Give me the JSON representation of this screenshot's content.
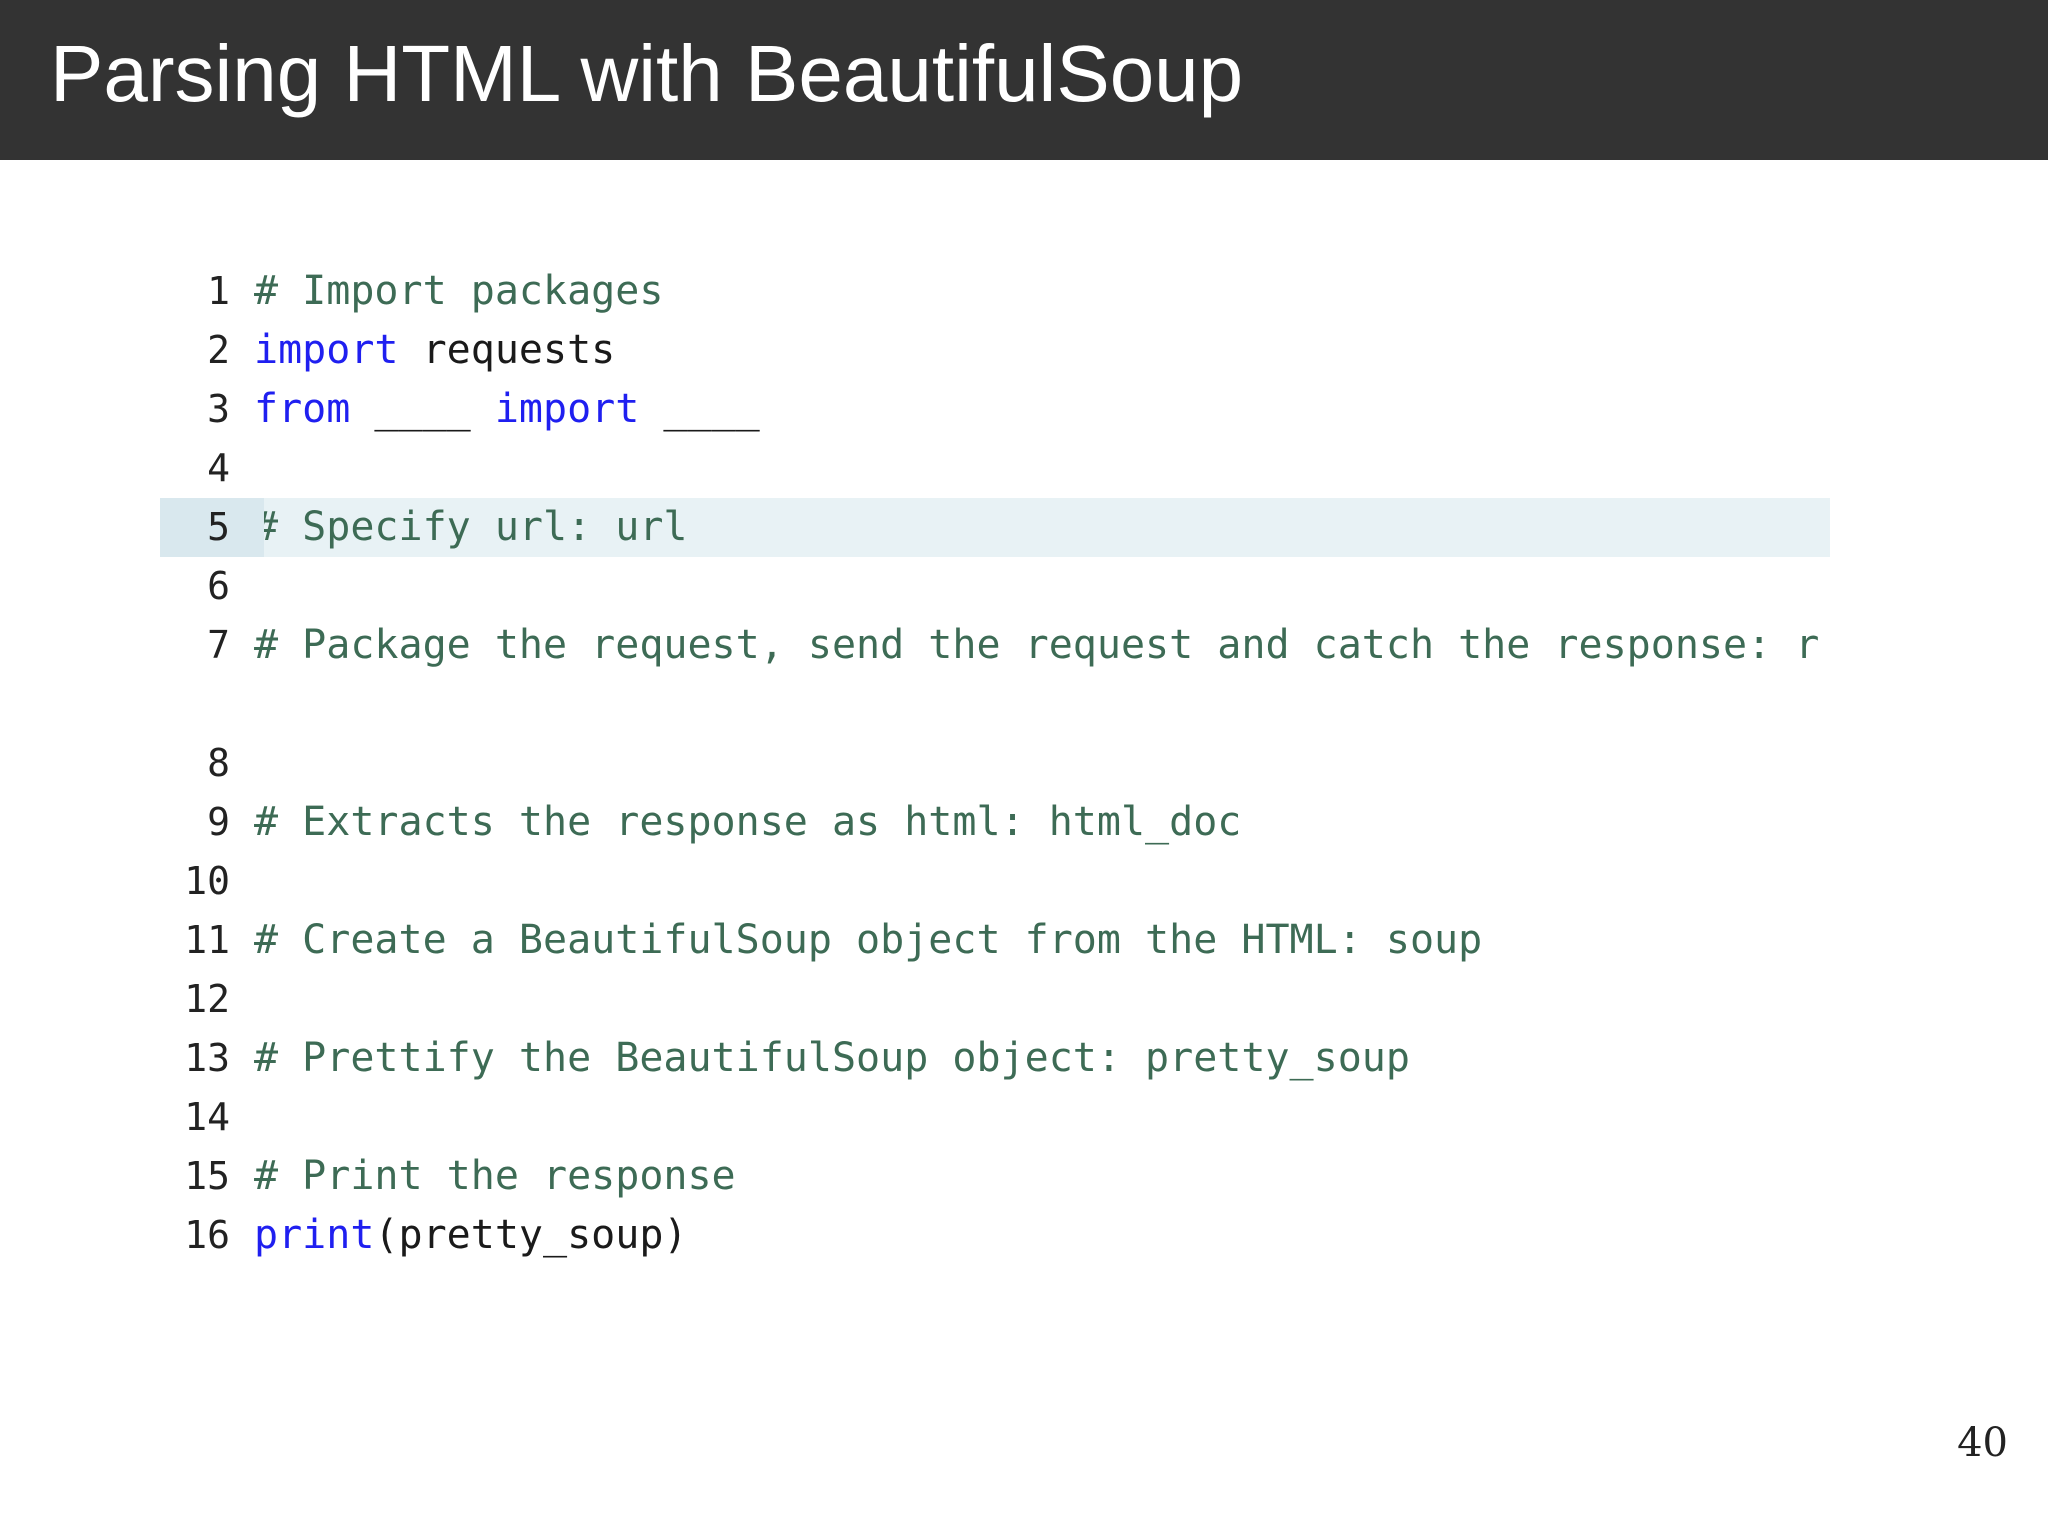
{
  "slide": {
    "title": "Parsing HTML with BeautifulSoup",
    "page_number": "40"
  },
  "editor": {
    "active_line": "5",
    "lines": [
      {
        "number": "1",
        "tokens": [
          {
            "type": "comment",
            "text": "# Import packages"
          }
        ]
      },
      {
        "number": "2",
        "tokens": [
          {
            "type": "keyword",
            "text": "import"
          },
          {
            "type": "plain",
            "text": " requests"
          }
        ]
      },
      {
        "number": "3",
        "tokens": [
          {
            "type": "keyword",
            "text": "from"
          },
          {
            "type": "plain",
            "text": " ____ "
          },
          {
            "type": "keyword",
            "text": "import"
          },
          {
            "type": "plain",
            "text": " ____"
          }
        ]
      },
      {
        "number": "4",
        "tokens": []
      },
      {
        "number": "5",
        "tokens": [
          {
            "type": "comment",
            "text": "# Specify url: url"
          }
        ]
      },
      {
        "number": "6",
        "tokens": []
      },
      {
        "number": "7",
        "tokens": [
          {
            "type": "comment",
            "text": "# Package the request, send the request and catch the response: r"
          }
        ]
      },
      {
        "number": "8",
        "tokens": []
      },
      {
        "number": "9",
        "tokens": [
          {
            "type": "comment",
            "text": "# Extracts the response as html: html_doc"
          }
        ]
      },
      {
        "number": "10",
        "tokens": []
      },
      {
        "number": "11",
        "tokens": [
          {
            "type": "comment",
            "text": "# Create a BeautifulSoup object from the HTML: soup"
          }
        ]
      },
      {
        "number": "12",
        "tokens": []
      },
      {
        "number": "13",
        "tokens": [
          {
            "type": "comment",
            "text": "# Prettify the BeautifulSoup object: pretty_soup"
          }
        ]
      },
      {
        "number": "14",
        "tokens": []
      },
      {
        "number": "15",
        "tokens": [
          {
            "type": "comment",
            "text": "# Print the response"
          }
        ]
      },
      {
        "number": "16",
        "tokens": [
          {
            "type": "keyword",
            "text": "print"
          },
          {
            "type": "plain",
            "text": "(pretty_soup)"
          }
        ]
      }
    ],
    "cut_off_line_number": "17"
  },
  "colors": {
    "header_background": "#333333",
    "comment": "#3d6b55",
    "keyword": "#1f1ff0",
    "active_line": "#e8f2f5"
  }
}
